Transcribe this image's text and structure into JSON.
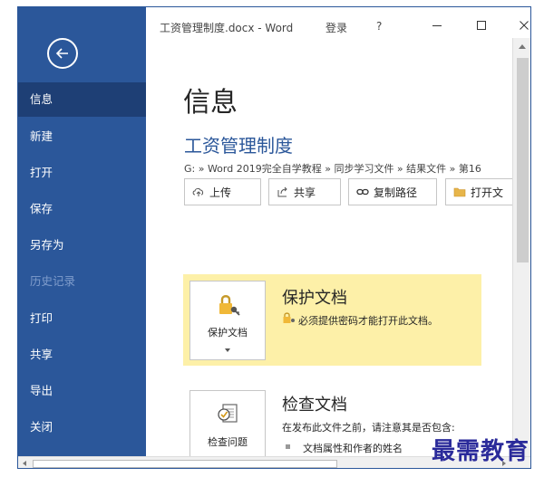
{
  "window": {
    "title": "工资管理制度.docx - Word",
    "login": "登录",
    "help": "?"
  },
  "sidebar": {
    "items": [
      {
        "label": "信息",
        "state": "active"
      },
      {
        "label": "新建",
        "state": "normal"
      },
      {
        "label": "打开",
        "state": "normal"
      },
      {
        "label": "保存",
        "state": "normal"
      },
      {
        "label": "另存为",
        "state": "normal"
      },
      {
        "label": "历史记录",
        "state": "disabled"
      },
      {
        "label": "打印",
        "state": "normal"
      },
      {
        "label": "共享",
        "state": "normal"
      },
      {
        "label": "导出",
        "state": "normal"
      },
      {
        "label": "关闭",
        "state": "normal"
      }
    ]
  },
  "main": {
    "page_title": "信息",
    "doc_name": "工资管理制度",
    "doc_path": "G: » Word 2019完全自学教程 » 同步学习文件 » 结果文件 » 第16",
    "actions": {
      "upload": "上传",
      "share": "共享",
      "copy_path": "复制路径",
      "open_location": "打开文"
    },
    "protect": {
      "button_label": "保护文档",
      "title": "保护文档",
      "desc": "必须提供密码才能打开此文档。"
    },
    "inspect": {
      "button_label": "检查问题",
      "title": "检查文档",
      "desc": "在发布此文件之前，请注意其是否包含:",
      "bullet": "文档属性和作者的姓名"
    }
  },
  "watermark": "最需教育",
  "colors": {
    "sidebar": "#2b579a",
    "sidebar_active": "#1e3f75",
    "accent_text": "#2b579a",
    "protect_highlight": "#fdf0a8"
  },
  "icons": [
    "back-arrow-icon",
    "upload-icon",
    "share-icon",
    "link-icon",
    "folder-icon",
    "lock-key-icon",
    "inspect-document-icon",
    "minimize-icon",
    "maximize-icon",
    "close-icon"
  ]
}
